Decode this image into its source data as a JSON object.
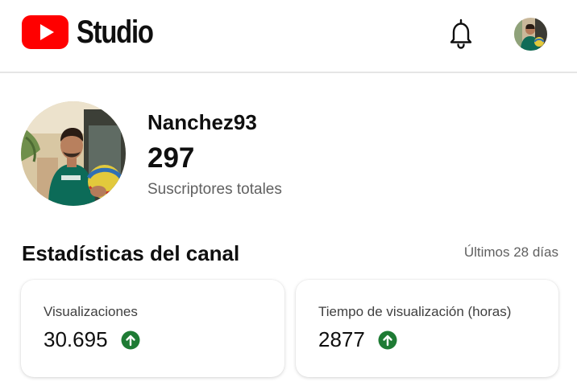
{
  "app": {
    "logo_text": "Studio",
    "brand_color": "#ff0000",
    "icons": {
      "logo": "youtube-play-logo",
      "notifications": "bell-icon",
      "trend_up": "arrow-up-circle-icon"
    }
  },
  "channel": {
    "name": "Nanchez93",
    "subscribers": "297",
    "subscribers_label": "Suscriptores totales"
  },
  "stats": {
    "title": "Estadísticas del canal",
    "period": "Últimos 28 días",
    "trend_color": "#1e7b34",
    "cards": [
      {
        "label": "Visualizaciones",
        "value": "30.695",
        "trend": "up"
      },
      {
        "label": "Tiempo de visualización (horas)",
        "value": "2877",
        "trend": "up"
      }
    ]
  }
}
